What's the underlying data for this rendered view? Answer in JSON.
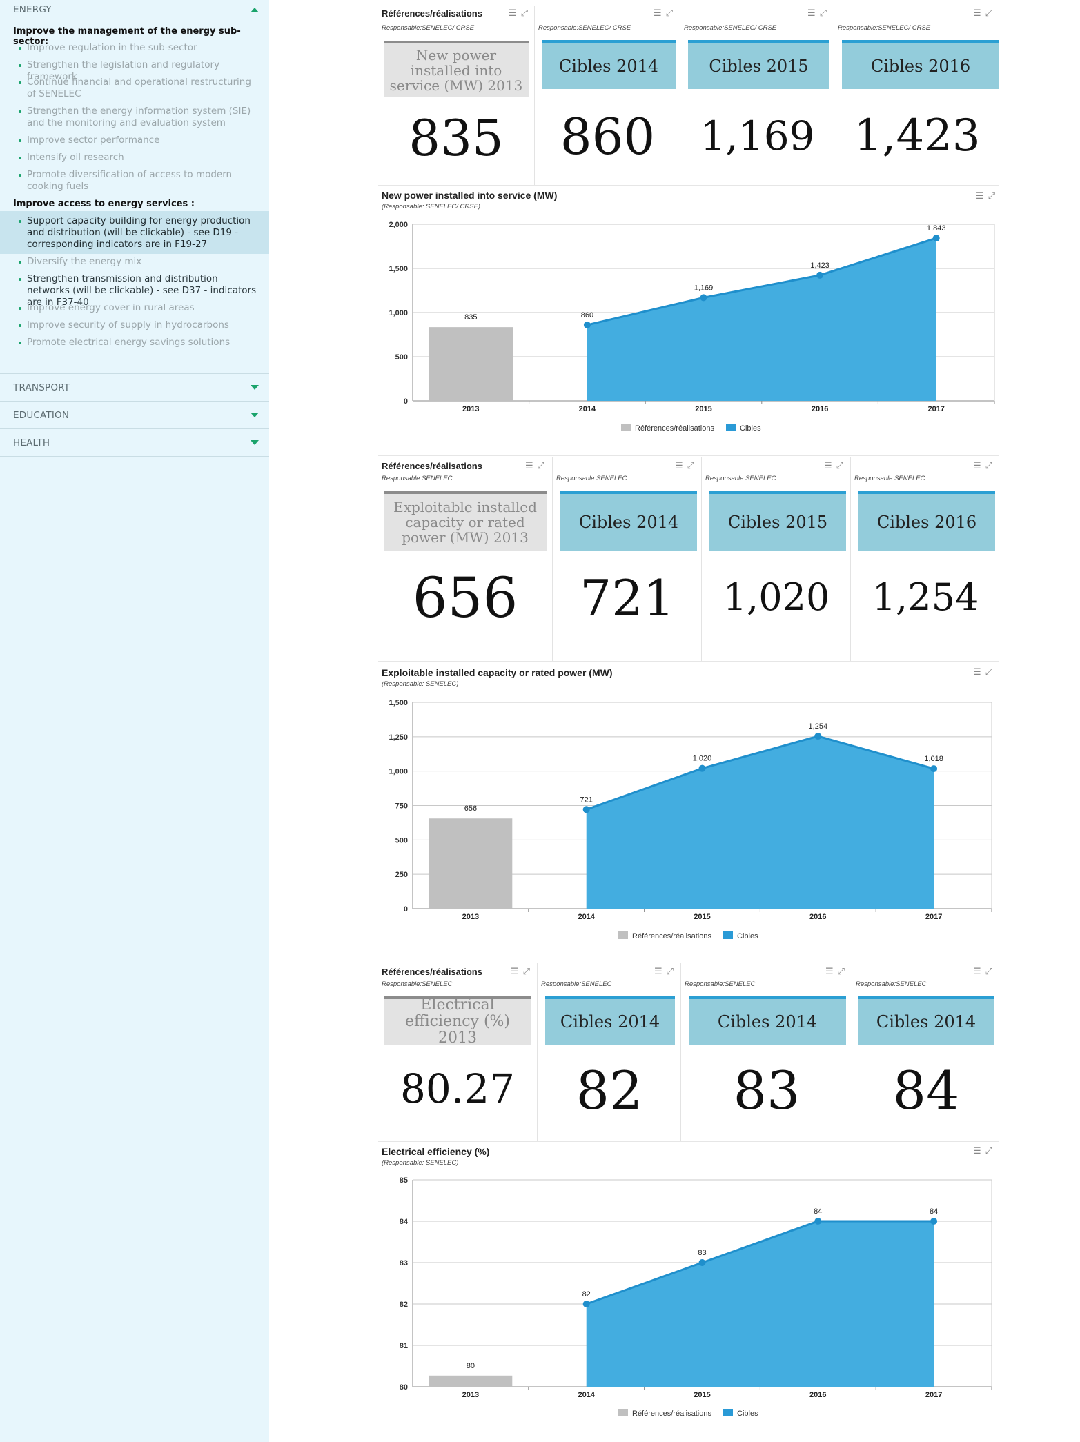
{
  "sidebar": {
    "energy": {
      "title": "ENERGY",
      "group1": "Improve the management of the energy sub-sector:",
      "group1_items": [
        "Improve regulation in the sub-sector",
        "Strengthen the legislation and regulatory framework",
        "Continue financial and operational restructuring of SENELEC",
        "Strengthen the energy information system (SIE) and the monitoring and evaluation system",
        "Improve sector performance",
        "Intensify oil research",
        "Promote diversification of access to modern cooking fuels"
      ],
      "group2": "Improve access to energy services :",
      "group2_items": [
        "Support capacity building for energy production and distribution (will be clickable) - see D19 - corresponding indicators are in F19-27",
        "Diversify the energy mix",
        "Strengthen transmission and distribution networks (will be clickable) - see D37 - indicators are in F37-40",
        "Improve energy cover in rural areas",
        "Improve security of supply in hydrocarbons",
        "Promote electrical energy savings solutions"
      ]
    },
    "transport": "TRANSPORT",
    "education": "EDUCATION",
    "health": "HEALTH"
  },
  "icons": {
    "menu": "hamburger-menu-icon",
    "expand": "expand-icon"
  },
  "colors": {
    "accent": "#1aa36b",
    "bar": "#c0c0c0",
    "area": "#43ade0",
    "line": "#1f8fcc",
    "teal": "#93ccdb"
  },
  "sections": [
    {
      "cards": [
        {
          "header": "Références/réalisations",
          "sub": "Responsable:SENELEC/ CRSE",
          "label": "New power installed into service (MW) 2013",
          "value": "835"
        },
        {
          "sub": "Responsable:SENELEC/ CRSE",
          "label": "Cibles 2014",
          "value": "860"
        },
        {
          "sub": "Responsable:SENELEC/ CRSE",
          "label": "Cibles 2015",
          "value": "1,169"
        },
        {
          "sub": "Responsable:SENELEC/ CRSE",
          "label": "Cibles 2016",
          "value": "1,423"
        }
      ],
      "chart_title": "New power installed into service (MW)",
      "chart_sub": "(Responsable: SENELEC/ CRSE)"
    },
    {
      "cards": [
        {
          "header": "Références/réalisations",
          "sub": "Responsable:SENELEC",
          "label": "Exploitable installed capacity or rated power (MW) 2013",
          "value": "656"
        },
        {
          "sub": "Responsable:SENELEC",
          "label": "Cibles 2014",
          "value": "721"
        },
        {
          "sub": "Responsable:SENELEC",
          "label": "Cibles 2015",
          "value": "1,020"
        },
        {
          "sub": "Responsable:SENELEC",
          "label": "Cibles 2016",
          "value": "1,254"
        }
      ],
      "chart_title": "Exploitable installed capacity or rated power (MW)",
      "chart_sub": "(Responsable: SENELEC)"
    },
    {
      "cards": [
        {
          "header": "Références/réalisations",
          "sub": "Responsable:SENELEC",
          "label": "Electrical efficiency (%) 2013",
          "value": "80.27"
        },
        {
          "sub": "Responsable:SENELEC",
          "label": "Cibles 2014",
          "value": "82"
        },
        {
          "sub": "Responsable:SENELEC",
          "label": "Cibles 2014",
          "value": "83"
        },
        {
          "sub": "Responsable:SENELEC",
          "label": "Cibles 2014",
          "value": "84"
        }
      ],
      "chart_title": "Electrical efficiency (%)",
      "chart_sub": "(Responsable: SENELEC)"
    }
  ],
  "chart_data": [
    {
      "type": "bar+area",
      "categories": [
        "2013",
        "2014",
        "2015",
        "2016",
        "2017"
      ],
      "ylim": [
        0,
        2000
      ],
      "yticks": [
        "0",
        "500",
        "1,000",
        "1,500",
        "2,000"
      ],
      "yticks_values": [
        0,
        500,
        1000,
        1500,
        2000
      ],
      "series": [
        {
          "name": "Références/réalisations",
          "type": "bar",
          "x": [
            "2013"
          ],
          "values": [
            835
          ],
          "labels": [
            "835"
          ]
        },
        {
          "name": "Cibles",
          "type": "area",
          "x": [
            "2014",
            "2015",
            "2016",
            "2017"
          ],
          "values": [
            860,
            1169,
            1423,
            1843
          ],
          "labels": [
            "860",
            "1,169",
            "1,423",
            "1,843"
          ]
        }
      ],
      "grid": true,
      "legend": "bottom-center"
    },
    {
      "type": "bar+area",
      "categories": [
        "2013",
        "2014",
        "2015",
        "2016",
        "2017"
      ],
      "ylim": [
        0,
        1500
      ],
      "yticks": [
        "0",
        "250",
        "500",
        "750",
        "1,000",
        "1,250",
        "1,500"
      ],
      "yticks_values": [
        0,
        250,
        500,
        750,
        1000,
        1250,
        1500
      ],
      "series": [
        {
          "name": "Références/réalisations",
          "type": "bar",
          "x": [
            "2013"
          ],
          "values": [
            656
          ],
          "labels": [
            "656"
          ]
        },
        {
          "name": "Cibles",
          "type": "area",
          "x": [
            "2014",
            "2015",
            "2016",
            "2017"
          ],
          "values": [
            721,
            1020,
            1254,
            1018
          ],
          "labels": [
            "721",
            "1,020",
            "1,254",
            "1,018"
          ]
        }
      ],
      "grid": true,
      "legend": "bottom-center"
    },
    {
      "type": "bar+area",
      "categories": [
        "2013",
        "2014",
        "2015",
        "2016",
        "2017"
      ],
      "ylim": [
        80,
        85
      ],
      "yticks": [
        "80",
        "81",
        "82",
        "83",
        "84",
        "85"
      ],
      "yticks_values": [
        80,
        81,
        82,
        83,
        84,
        85
      ],
      "series": [
        {
          "name": "Références/réalisations",
          "type": "bar",
          "x": [
            "2013"
          ],
          "values": [
            80.27
          ],
          "labels": [
            "80"
          ]
        },
        {
          "name": "Cibles",
          "type": "area",
          "x": [
            "2014",
            "2015",
            "2016",
            "2017"
          ],
          "values": [
            82,
            83,
            84,
            84
          ],
          "labels": [
            "82",
            "83",
            "84",
            "84"
          ]
        }
      ],
      "grid": true,
      "legend": "bottom-center"
    }
  ]
}
